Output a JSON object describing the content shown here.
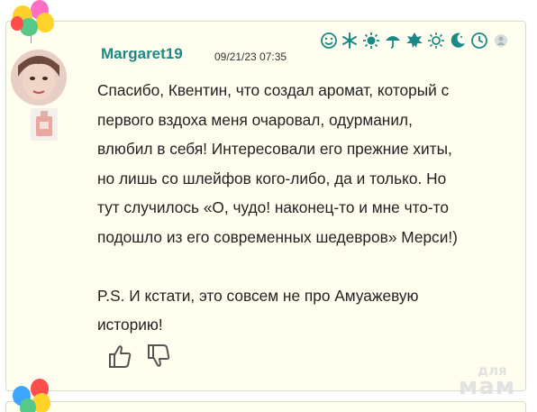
{
  "comment": {
    "author": "Margaret19",
    "date": "09/21/23 07:35",
    "text_lines": [
      "Спасибо, Квентин, что создал аромат, который с",
      "первого вздоха меня очаровал, одурманил,",
      "влюбил в себя! Интересовали его прежние хиты,",
      "но лишь со шлейфов кого-либо, да и только. Но",
      "тут случилось «О, чудо! наконец-то и мне что-то",
      "подошло из его современных шедевров» Мерси!)",
      "",
      "P.S. И кстати, это совсем не про Амуажевую",
      "историю!"
    ],
    "mood_icons": [
      "smile-icon",
      "snowflake-icon",
      "sun-icon",
      "umbrella-icon",
      "leaf-icon",
      "sun-outline-icon",
      "moon-icon",
      "clock-icon",
      "person-icon"
    ],
    "actions": [
      "thumbs-up-icon",
      "thumbs-down-icon"
    ]
  },
  "watermark": {
    "line1": "для",
    "line2": "мам"
  },
  "colors": {
    "author": "#1b8a86",
    "icons": "#1b8a86",
    "card_bg": "#fffeef",
    "border": "#d8dccb"
  }
}
